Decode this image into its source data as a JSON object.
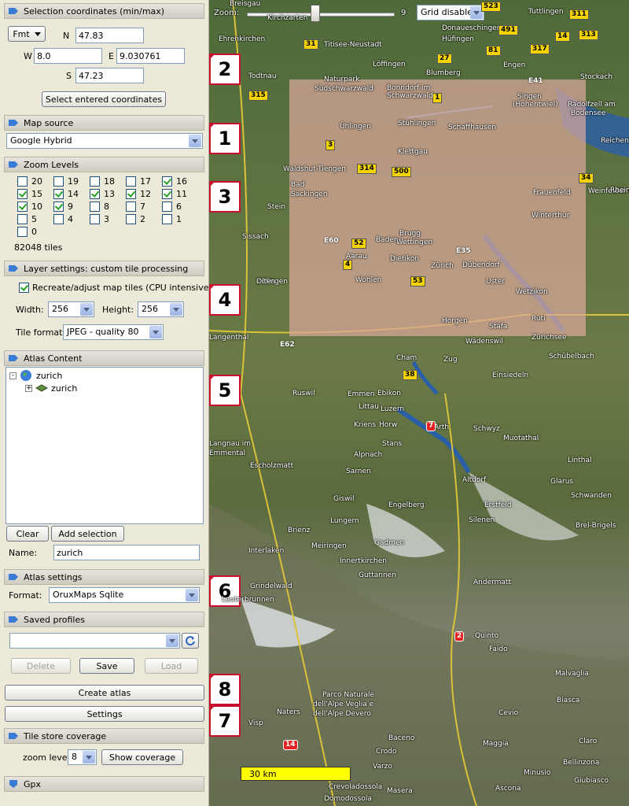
{
  "selection": {
    "title": "Selection coordinates (min/max)",
    "fmt_button": "Fmt",
    "n_label": "N",
    "n_value": "47.83",
    "w_label": "W",
    "w_value": "8.0",
    "e_label": "E",
    "e_value": "9.030761",
    "s_label": "S",
    "s_value": "47.23",
    "apply_button": "Select entered coordinates"
  },
  "map_source": {
    "title": "Map source",
    "value": "Google Hybrid"
  },
  "zoom_levels": {
    "title": "Zoom Levels",
    "items": [
      {
        "label": "20",
        "checked": false
      },
      {
        "label": "19",
        "checked": false
      },
      {
        "label": "18",
        "checked": false
      },
      {
        "label": "17",
        "checked": false
      },
      {
        "label": "16",
        "checked": true
      },
      {
        "label": "15",
        "checked": true
      },
      {
        "label": "14",
        "checked": true
      },
      {
        "label": "13",
        "checked": true
      },
      {
        "label": "12",
        "checked": true
      },
      {
        "label": "11",
        "checked": true
      },
      {
        "label": "10",
        "checked": true
      },
      {
        "label": "9",
        "checked": true
      },
      {
        "label": "8",
        "checked": false
      },
      {
        "label": "7",
        "checked": false
      },
      {
        "label": "6",
        "checked": false
      },
      {
        "label": "5",
        "checked": false
      },
      {
        "label": "4",
        "checked": false
      },
      {
        "label": "3",
        "checked": false
      },
      {
        "label": "2",
        "checked": false
      },
      {
        "label": "1",
        "checked": false
      },
      {
        "label": "0",
        "checked": false
      }
    ],
    "tile_count": "82048 tiles"
  },
  "layer_settings": {
    "title": "Layer settings: custom tile processing",
    "recreate_label": "Recreate/adjust map tiles (CPU intensive)",
    "recreate_checked": true,
    "width_label": "Width:",
    "width_value": "256",
    "height_label": "Height:",
    "height_value": "256",
    "format_label": "Tile format:",
    "format_value": "JPEG - quality 80"
  },
  "atlas_content": {
    "title": "Atlas Content",
    "root": "zurich",
    "child": "zurich",
    "clear_button": "Clear",
    "add_button": "Add selection",
    "name_label": "Name:",
    "name_value": "zurich"
  },
  "atlas_settings": {
    "title": "Atlas settings",
    "format_label": "Format:",
    "format_value": "OruxMaps Sqlite"
  },
  "saved_profiles": {
    "title": "Saved profiles",
    "value": "",
    "delete_button": "Delete",
    "save_button": "Save",
    "load_button": "Load"
  },
  "actions": {
    "create_atlas": "Create atlas",
    "settings": "Settings"
  },
  "coverage": {
    "title": "Tile store coverage",
    "zoom_label": "zoom level",
    "zoom_value": "8",
    "show_button": "Show coverage"
  },
  "gpx": {
    "title": "Gpx"
  },
  "map": {
    "zoom_label": "Zoom:",
    "zoom_value": "9",
    "grid_value": "Grid disabled",
    "scale_label": "30 km",
    "markers": [
      "2",
      "1",
      "3",
      "4",
      "5",
      "6",
      "8",
      "7"
    ],
    "places": [
      "Breisgau",
      "Kirchzarten",
      "Tuttlingen",
      "Ehrenkirchen",
      "Titisee-Neustadt",
      "Donaueschingen",
      "Hüfingen",
      "Todtnau",
      "Naturpark",
      "Südschwarzwald",
      "Löffingen",
      "Blumberg",
      "Engen",
      "Stockach",
      "Bonndorf im",
      "Schwarzwald",
      "Singen",
      "(Hohentwiel)",
      "Radolfzell am",
      "Bodensee",
      "Ühlingen",
      "Stühlingen",
      "Schaffhausen",
      "Waldshut-Tiengen",
      "Bad",
      "Säckingen",
      "Klettgau",
      "Frauenfeld",
      "Weinfelden",
      "Winterthur",
      "Brugg",
      "Baden",
      "Wettingen",
      "Aarau",
      "Dietikon",
      "Zürich",
      "Dübendorf",
      "Wohlen",
      "Uster",
      "Wetzikon",
      "Zofingen",
      "Olten",
      "Sissach",
      "Langenthal",
      "Horgen",
      "Stäfa",
      "Rüti",
      "Wädenswil",
      "Zürichsee",
      "Schübelbach",
      "Cham",
      "Zug",
      "Ruswil",
      "Emmen",
      "Ebikon",
      "Luzern",
      "Einsiedeln",
      "Littau",
      "Kriens",
      "Horw",
      "Arth",
      "Schwyz",
      "Muotathal",
      "Stans",
      "Alpnach",
      "Sarnen",
      "Engelberg",
      "Altdorf",
      "Erstfeld",
      "Silenen",
      "Linthal",
      "Glarus",
      "Schwanden",
      "Langnau im",
      "Emmental",
      "Escholzmatt",
      "Giswil",
      "Lungern",
      "Brienz",
      "Meiringen",
      "Innertkirchen",
      "Gadmen",
      "Guttannen",
      "Andermatt",
      "Interlaken",
      "Grindelwald",
      "Lauterbrunnen",
      "Quinto",
      "Faido",
      "Malvaglia",
      "Biasca",
      "Claro",
      "Bellinzona",
      "Giubiasco",
      "Parco Naturale",
      "dell'Alpe Veglia e",
      "dell'Alpe Devero",
      "Naters",
      "Visp",
      "Cevio",
      "Baceno",
      "Crodo",
      "Maggia",
      "Varzo",
      "Minusio",
      "Ascona",
      "Crevoladossola",
      "Domodossola",
      "Masera",
      "Brel-Brigels",
      "Reichenau",
      "Stein",
      "Rheinfelden"
    ],
    "roads": [
      "523",
      "311",
      "313",
      "14",
      "31",
      "491",
      "317",
      "315",
      "27",
      "81",
      "E41",
      "E60",
      "E35",
      "E62",
      "2",
      "14",
      "7",
      "38",
      "34",
      "314",
      "500",
      "1",
      "3",
      "4",
      "52",
      "53"
    ]
  }
}
